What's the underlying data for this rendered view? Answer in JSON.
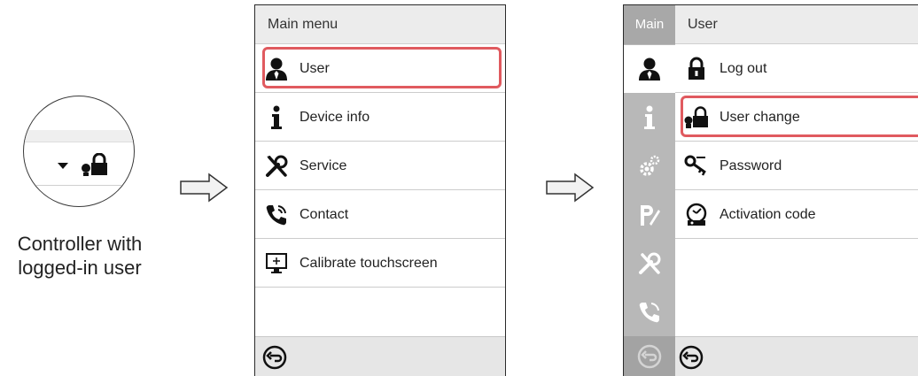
{
  "caption": {
    "line1": "Controller with",
    "line2": "logged-in user"
  },
  "icons": {
    "magnifier": [
      "chevron-down-icon",
      "lock-user-icon"
    ],
    "flow": [
      "arrow-right-icon",
      "arrow-right-icon"
    ]
  },
  "main_menu": {
    "title": "Main menu",
    "items": [
      {
        "label": "User",
        "icon": "user-icon",
        "highlighted": true
      },
      {
        "label": "Device info",
        "icon": "info-icon",
        "highlighted": false
      },
      {
        "label": "Service",
        "icon": "tools-icon",
        "highlighted": false
      },
      {
        "label": "Contact",
        "icon": "phone-icon",
        "highlighted": false
      },
      {
        "label": "Calibrate touchscreen",
        "icon": "monitor-icon",
        "highlighted": false
      }
    ],
    "footer_icon": "back-icon"
  },
  "user_menu": {
    "sidebar_title": "Main",
    "title": "User",
    "sidebar_items": [
      "user-icon",
      "info-icon",
      "settings-icon",
      "program-icon",
      "tools-icon",
      "phone-icon"
    ],
    "active_sidebar_item": "user-icon",
    "items": [
      {
        "label": "Log out",
        "icon": "lock-icon",
        "highlighted": false
      },
      {
        "label": "User change",
        "icon": "user-change-icon",
        "highlighted": true
      },
      {
        "label": "Password",
        "icon": "key-icon",
        "highlighted": false
      },
      {
        "label": "Activation code",
        "icon": "activation-icon",
        "highlighted": false
      }
    ],
    "footer_icons": [
      "back-icon-disabled",
      "back-icon"
    ]
  },
  "colors": {
    "highlight": "#e05a5f",
    "header_bg": "#ececec",
    "sidebar_bg": "#b8b8b8"
  }
}
